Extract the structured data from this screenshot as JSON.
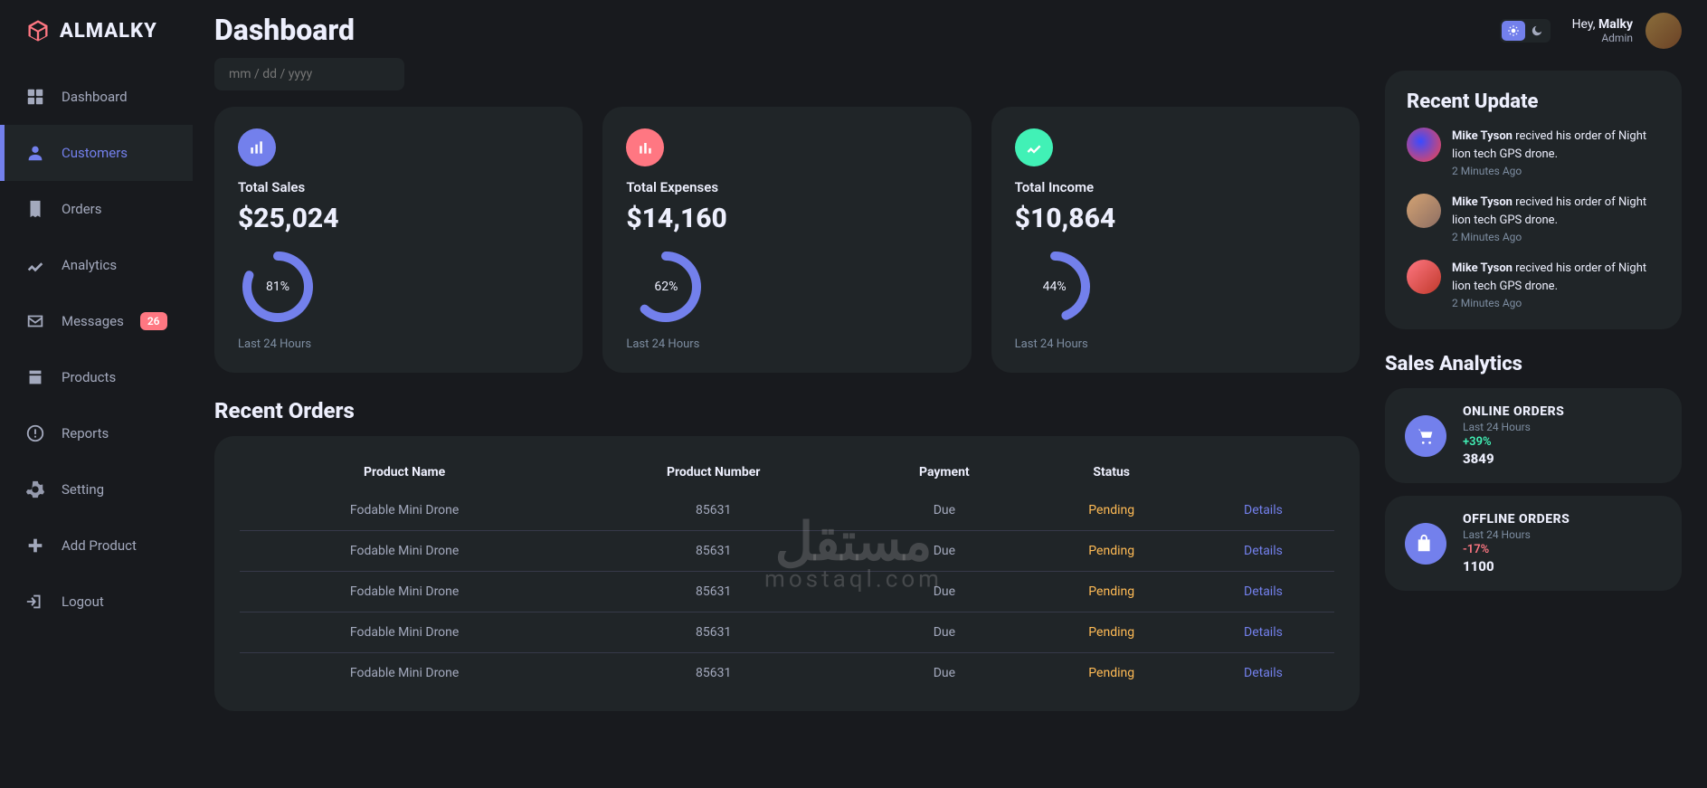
{
  "brand": {
    "name": "ALMALKY"
  },
  "sidebar": {
    "items": [
      {
        "label": "Dashboard"
      },
      {
        "label": "Customers"
      },
      {
        "label": "Orders"
      },
      {
        "label": "Analytics"
      },
      {
        "label": "Messages",
        "badge": "26"
      },
      {
        "label": "Products"
      },
      {
        "label": "Reports"
      },
      {
        "label": "Setting"
      },
      {
        "label": "Add Product"
      },
      {
        "label": "Logout"
      }
    ]
  },
  "header": {
    "title": "Dashboard",
    "date_placeholder": "mm / dd / yyyy",
    "greeting_prefix": "Hey, ",
    "greeting_name": "Malky",
    "role": "Admin"
  },
  "insights": [
    {
      "label": "Total Sales",
      "value": "$25,024",
      "percent": "81%",
      "progress": 81,
      "time": "Last 24 Hours",
      "icon_color": "blue"
    },
    {
      "label": "Total Expenses",
      "value": "$14,160",
      "percent": "62%",
      "progress": 62,
      "time": "Last 24 Hours",
      "icon_color": "red"
    },
    {
      "label": "Total Income",
      "value": "$10,864",
      "percent": "44%",
      "progress": 44,
      "time": "Last 24 Hours",
      "icon_color": "green"
    }
  ],
  "orders": {
    "title": "Recent Orders",
    "columns": [
      "Product Name",
      "Product Number",
      "Payment",
      "Status",
      ""
    ],
    "details_label": "Details",
    "rows": [
      {
        "name": "Fodable Mini Drone",
        "number": "85631",
        "payment": "Due",
        "status": "Pending"
      },
      {
        "name": "Fodable Mini Drone",
        "number": "85631",
        "payment": "Due",
        "status": "Pending"
      },
      {
        "name": "Fodable Mini Drone",
        "number": "85631",
        "payment": "Due",
        "status": "Pending"
      },
      {
        "name": "Fodable Mini Drone",
        "number": "85631",
        "payment": "Due",
        "status": "Pending"
      },
      {
        "name": "Fodable Mini Drone",
        "number": "85631",
        "payment": "Due",
        "status": "Pending"
      }
    ]
  },
  "updates": {
    "title": "Recent Update",
    "items": [
      {
        "name": "Mike Tyson",
        "text": " recived his order of Night lion tech GPS drone.",
        "time": "2 Minutes Ago"
      },
      {
        "name": "Mike Tyson",
        "text": " recived his order of Night lion tech GPS drone.",
        "time": "2 Minutes Ago"
      },
      {
        "name": "Mike Tyson",
        "text": " recived his order of Night lion tech GPS drone.",
        "time": "2 Minutes Ago"
      }
    ]
  },
  "analytics": {
    "title": "Sales Analytics",
    "items": [
      {
        "label": "ONLINE ORDERS",
        "sub": "Last 24 Hours",
        "change": "+39%",
        "change_class": "change-pos",
        "value": "3849"
      },
      {
        "label": "OFFLINE ORDERS",
        "sub": "Last 24 Hours",
        "change": "-17%",
        "change_class": "change-neg",
        "value": "1100"
      }
    ]
  },
  "watermark": {
    "big": "مستقل",
    "small": "mostaql.com"
  }
}
